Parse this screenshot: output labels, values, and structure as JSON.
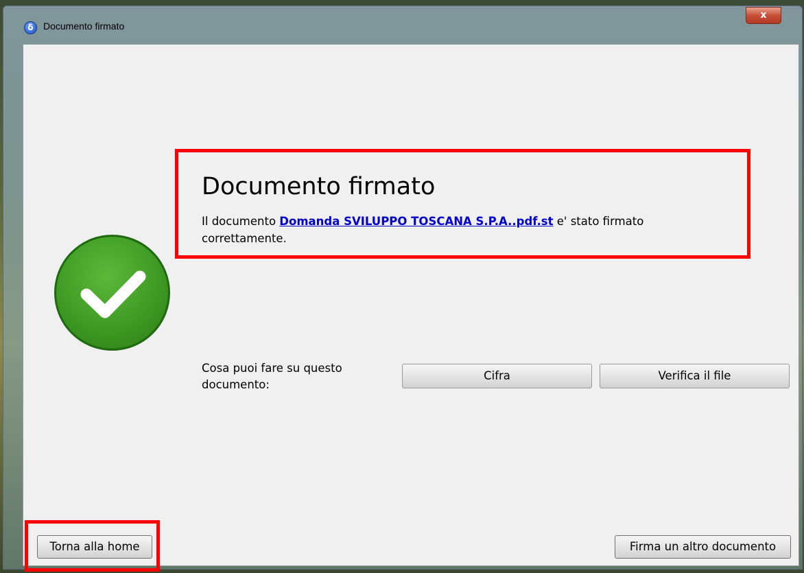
{
  "window": {
    "title": "Documento firmato",
    "close_label": "x"
  },
  "main": {
    "heading": "Documento firmato",
    "message_prefix": "Il documento ",
    "document_link": "Domanda SVILUPPO TOSCANA S.P.A..pdf.st",
    "message_suffix": " e' stato firmato correttamente."
  },
  "actions": {
    "label": "Cosa puoi fare su questo documento:",
    "encrypt_label": "Cifra",
    "verify_label": "Verifica il file"
  },
  "footer": {
    "home_label": "Torna alla home",
    "sign_another_label": "Firma un altro documento"
  },
  "colors": {
    "highlight": "#ff0000",
    "success": "#3e9a23",
    "link": "#0000cc"
  }
}
